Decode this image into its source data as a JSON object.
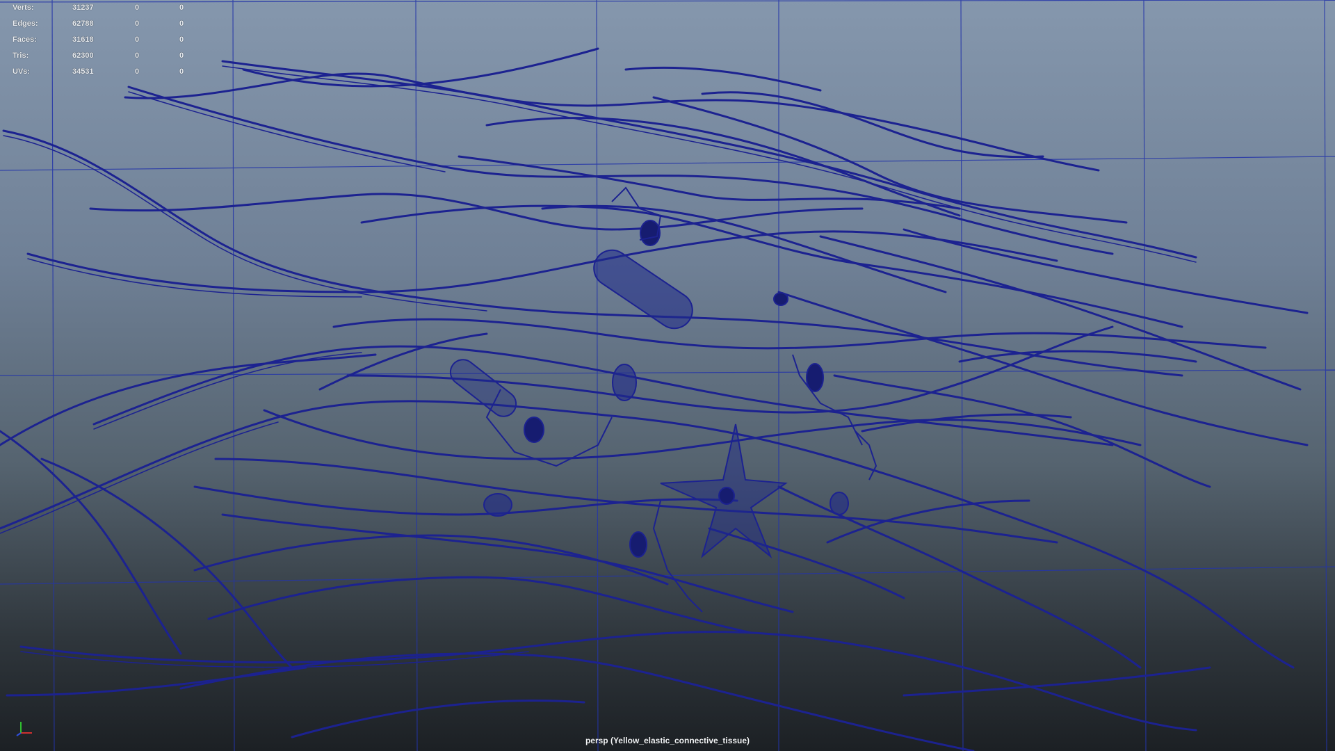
{
  "hud": {
    "rows": [
      {
        "label": "Verts:",
        "total": "31237",
        "selected": "0",
        "component": "0"
      },
      {
        "label": "Edges:",
        "total": "62788",
        "selected": "0",
        "component": "0"
      },
      {
        "label": "Faces:",
        "total": "31618",
        "selected": "0",
        "component": "0"
      },
      {
        "label": "Tris:",
        "total": "62300",
        "selected": "0",
        "component": "0"
      },
      {
        "label": "UVs:",
        "total": "34531",
        "selected": "0",
        "component": "0"
      }
    ]
  },
  "viewport": {
    "camera_label": "persp (Yellow_elastic_connective_tissue)",
    "wire_color": "#1a1f8a",
    "grid_color": "#1e2fa0",
    "background_top": "#8597ad",
    "background_bottom": "#1c2024"
  },
  "axis_gizmo": {
    "icon": "xyz-axis-icon",
    "x_color": "#d03030",
    "y_color": "#30c030",
    "z_color": "#3050e0"
  }
}
